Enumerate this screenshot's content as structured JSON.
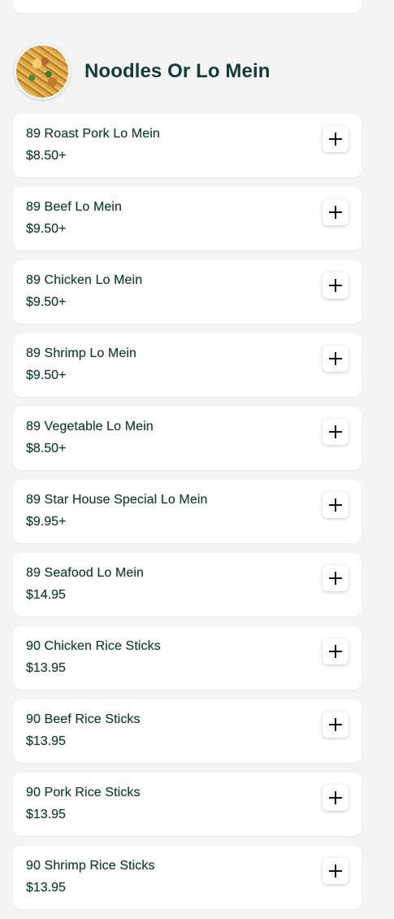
{
  "section": {
    "title": "Noodles Or Lo Mein",
    "thumbnail": "noodles-dish-image"
  },
  "items": [
    {
      "name": "89 Roast Pork Lo Mein",
      "price": "$8.50+"
    },
    {
      "name": "89 Beef Lo Mein",
      "price": "$9.50+"
    },
    {
      "name": "89 Chicken Lo Mein",
      "price": "$9.50+"
    },
    {
      "name": "89 Shrimp Lo Mein",
      "price": "$9.50+"
    },
    {
      "name": "89 Vegetable Lo Mein",
      "price": "$8.50+"
    },
    {
      "name": "89 Star House Special Lo Mein",
      "price": "$9.95+"
    },
    {
      "name": "89 Seafood Lo Mein",
      "price": "$14.95"
    },
    {
      "name": "90 Chicken Rice Sticks",
      "price": "$13.95"
    },
    {
      "name": "90 Beef Rice Sticks",
      "price": "$13.95"
    },
    {
      "name": "90 Pork Rice Sticks",
      "price": "$13.95"
    },
    {
      "name": "90 Shrimp Rice Sticks",
      "price": "$13.95"
    }
  ],
  "icons": {
    "add": "plus-icon"
  },
  "colors": {
    "background": "#f4f4f4",
    "card": "#ffffff",
    "text": "#173f3a",
    "title": "#123b36"
  }
}
